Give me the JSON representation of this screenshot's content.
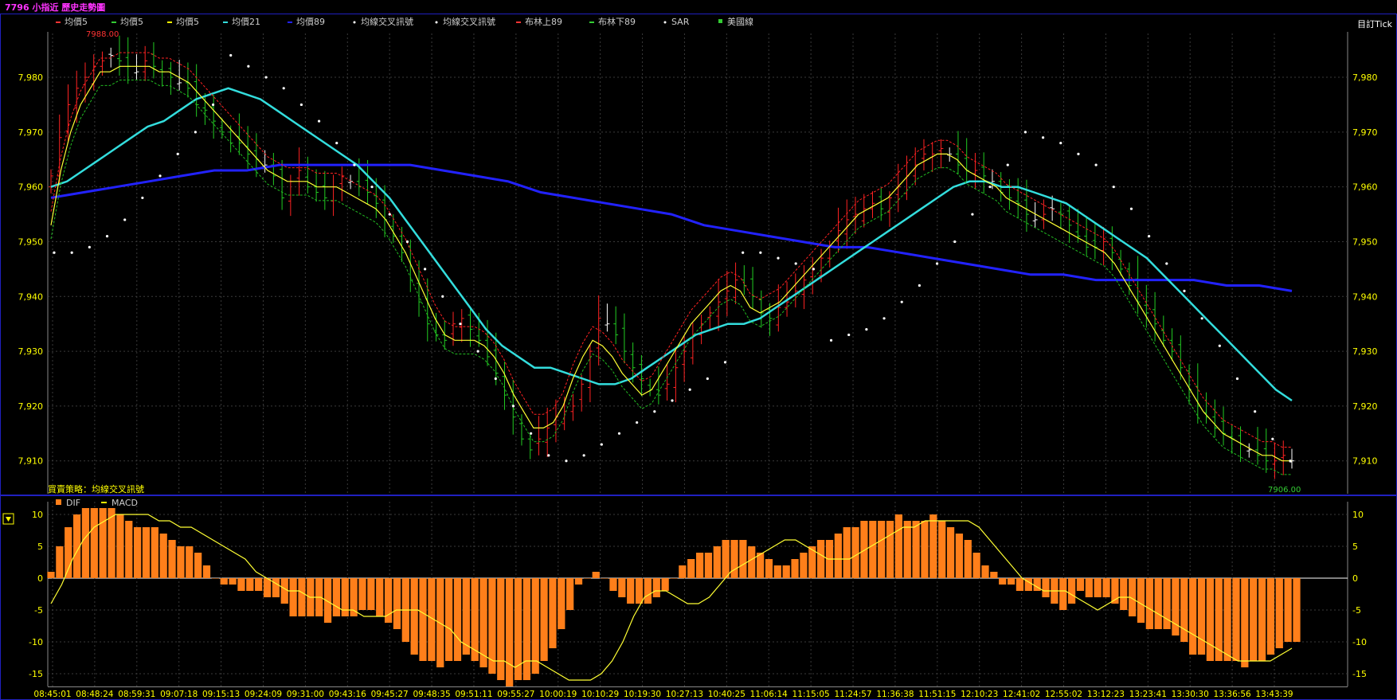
{
  "window": {
    "title": "7796 小指近  歷史走勢圖",
    "tick_label": "目訂Tick",
    "strategy_label": "買賣策略：均線交叉訊號"
  },
  "legend_main": [
    {
      "label": "均價5",
      "color": "#ff3333",
      "marker": "dash"
    },
    {
      "label": "均價5",
      "color": "#33cc33",
      "marker": "dash"
    },
    {
      "label": "均價5",
      "color": "#ffff00",
      "marker": "dash"
    },
    {
      "label": "均價21",
      "color": "#33dddd",
      "marker": "dash"
    },
    {
      "label": "均價89",
      "color": "#2222ff",
      "marker": "dash"
    },
    {
      "label": "均線交叉訊號",
      "color": "#ffffff",
      "marker": "dot"
    },
    {
      "label": "均線交叉訊號",
      "color": "#ffffff",
      "marker": "dot"
    },
    {
      "label": "布林上89",
      "color": "#ff3333",
      "marker": "dash"
    },
    {
      "label": "布林下89",
      "color": "#33cc33",
      "marker": "dash"
    },
    {
      "label": "SAR",
      "color": "#ffffff",
      "marker": "dot"
    },
    {
      "label": "美國線",
      "color": "#33cc33",
      "marker": "square"
    }
  ],
  "legend_macd": [
    {
      "label": "DIF",
      "color": "#ff7f1a",
      "marker": "square"
    },
    {
      "label": "MACD",
      "color": "#ffff00",
      "marker": "dash"
    }
  ],
  "colors": {
    "up": "#ff2222",
    "down": "#22cc22",
    "neutral": "#ffffff",
    "ma_yellow": "#ffff33",
    "ma21": "#33dddd",
    "ma89": "#2222ff",
    "boll": "#ff2222",
    "boll_low": "#22bb22",
    "sar": "#ffffff",
    "dif": "#ff7f1a",
    "macd": "#ffff33",
    "axis_text": "#ffff00",
    "grid": "#3a3a3a",
    "frame": "#2020c0"
  },
  "chart_data": [
    {
      "type": "candlestick",
      "title": "7796 小指近  歷史走勢圖",
      "ylim": [
        7904,
        7988
      ],
      "yticks": [
        7910,
        7920,
        7930,
        7940,
        7950,
        7960,
        7970,
        7980
      ],
      "ytick_labels": [
        "7,910",
        "7,920",
        "7,930",
        "7,940",
        "7,950",
        "7,960",
        "7,970",
        "7,980"
      ],
      "max_marker": "7988.00",
      "min_marker": "7906.00",
      "close": [
        7962,
        7969,
        7975,
        7978,
        7980,
        7982,
        7983,
        7984,
        7983,
        7982,
        7981,
        7983,
        7982,
        7981,
        7980,
        7979,
        7978,
        7975,
        7974,
        7972,
        7970,
        7968,
        7968,
        7966,
        7965,
        7964,
        7962,
        7958,
        7961,
        7963,
        7960,
        7959,
        7958,
        7960,
        7962,
        7961,
        7960,
        7959,
        7957,
        7954,
        7951,
        7948,
        7943,
        7939,
        7935,
        7933,
        7932,
        7935,
        7936,
        7934,
        7932,
        7929,
        7926,
        7922,
        7918,
        7914,
        7912,
        7914,
        7916,
        7918,
        7919,
        7920,
        7924,
        7930,
        7936,
        7935,
        7933,
        7930,
        7927,
        7925,
        7923,
        7922,
        7924,
        7927,
        7930,
        7933,
        7935,
        7937,
        7939,
        7941,
        7943,
        7942,
        7940,
        7937,
        7936,
        7938,
        7939,
        7941,
        7943,
        7945,
        7947,
        7949,
        7952,
        7954,
        7955,
        7956,
        7957,
        7956,
        7958,
        7960,
        7962,
        7964,
        7966,
        7966,
        7967,
        7966,
        7964,
        7963,
        7963,
        7962,
        7961,
        7959,
        7958,
        7957,
        7955,
        7954,
        7955,
        7956,
        7955,
        7953,
        7951,
        7949,
        7949,
        7950,
        7948,
        7945,
        7942,
        7939,
        7937,
        7935,
        7932,
        7930,
        7927,
        7923,
        7920,
        7918,
        7916,
        7915,
        7914,
        7913,
        7912,
        7911,
        7910,
        7910,
        7911,
        7910
      ],
      "ma5_yellow": [
        7953,
        7963,
        7970,
        7975,
        7978,
        7981,
        7981,
        7982,
        7982,
        7982,
        7982,
        7981,
        7981,
        7980,
        7979,
        7977,
        7975,
        7973,
        7971,
        7969,
        7967,
        7965,
        7963,
        7962,
        7961,
        7961,
        7961,
        7960,
        7960,
        7960,
        7959,
        7958,
        7957,
        7956,
        7954,
        7951,
        7948,
        7944,
        7940,
        7936,
        7933,
        7932,
        7932,
        7932,
        7931,
        7929,
        7926,
        7922,
        7919,
        7916,
        7916,
        7917,
        7920,
        7925,
        7929,
        7932,
        7931,
        7929,
        7926,
        7924,
        7922,
        7923,
        7926,
        7929,
        7932,
        7935,
        7937,
        7939,
        7941,
        7942,
        7941,
        7938,
        7937,
        7938,
        7939,
        7941,
        7943,
        7945,
        7947,
        7949,
        7951,
        7953,
        7955,
        7956,
        7957,
        7958,
        7960,
        7962,
        7964,
        7965,
        7966,
        7966,
        7965,
        7963,
        7962,
        7961,
        7960,
        7958,
        7957,
        7956,
        7955,
        7954,
        7953,
        7952,
        7951,
        7950,
        7949,
        7948,
        7946,
        7943,
        7940,
        7937,
        7934,
        7931,
        7928,
        7925,
        7922,
        7919,
        7917,
        7915,
        7914,
        7913,
        7912,
        7911,
        7911,
        7910,
        7910
      ],
      "ma21": [
        7960,
        7961,
        7963,
        7965,
        7967,
        7969,
        7971,
        7972,
        7974,
        7976,
        7977,
        7978,
        7977,
        7976,
        7974,
        7972,
        7970,
        7968,
        7966,
        7964,
        7961,
        7958,
        7954,
        7950,
        7946,
        7942,
        7938,
        7934,
        7931,
        7929,
        7927,
        7927,
        7926,
        7925,
        7924,
        7924,
        7925,
        7927,
        7929,
        7931,
        7933,
        7934,
        7935,
        7935,
        7936,
        7938,
        7940,
        7942,
        7944,
        7946,
        7948,
        7950,
        7952,
        7954,
        7956,
        7958,
        7960,
        7961,
        7961,
        7960,
        7960,
        7959,
        7958,
        7957,
        7955,
        7953,
        7951,
        7949,
        7947,
        7944,
        7941,
        7938,
        7935,
        7932,
        7929,
        7926,
        7923,
        7921
      ],
      "ma89": [
        7958,
        7959,
        7960,
        7961,
        7962,
        7963,
        7963,
        7964,
        7964,
        7964,
        7964,
        7964,
        7963,
        7962,
        7961,
        7959,
        7958,
        7957,
        7956,
        7955,
        7953,
        7952,
        7951,
        7950,
        7949,
        7949,
        7948,
        7947,
        7946,
        7945,
        7944,
        7944,
        7943,
        7943,
        7943,
        7943,
        7942,
        7942,
        7941
      ],
      "sar": [
        7948,
        7948,
        7949,
        7951,
        7954,
        7958,
        7962,
        7966,
        7970,
        7975,
        7984,
        7982,
        7980,
        7978,
        7975,
        7972,
        7968,
        7964,
        7960,
        7955,
        7950,
        7945,
        7940,
        7935,
        7930,
        7925,
        7920,
        7915,
        7911,
        7910,
        7911,
        7913,
        7915,
        7917,
        7919,
        7921,
        7923,
        7925,
        7928,
        7948,
        7948,
        7947,
        7946,
        7945,
        7932,
        7933,
        7934,
        7936,
        7939,
        7942,
        7946,
        7950,
        7955,
        7960,
        7964,
        7970,
        7969,
        7968,
        7966,
        7964,
        7960,
        7956,
        7951,
        7946,
        7941,
        7936,
        7931,
        7925,
        7919,
        7914,
        7910
      ]
    },
    {
      "type": "bar",
      "title": "MACD",
      "series": [
        {
          "name": "DIF",
          "values": [
            1,
            5,
            8,
            10,
            11,
            11,
            11,
            11,
            10,
            9,
            8,
            8,
            8,
            7,
            6,
            5,
            5,
            4,
            2,
            0,
            -1,
            -1,
            -2,
            -2,
            -2,
            -3,
            -3,
            -4,
            -6,
            -6,
            -6,
            -6,
            -7,
            -6,
            -6,
            -6,
            -5,
            -5,
            -6,
            -7,
            -8,
            -10,
            -12,
            -13,
            -13,
            -14,
            -13,
            -13,
            -12,
            -13,
            -14,
            -15,
            -16,
            -17,
            -16,
            -16,
            -15,
            -13,
            -11,
            -8,
            -5,
            -1,
            0,
            1,
            0,
            -2,
            -3,
            -4,
            -4,
            -4,
            -3,
            -2,
            0,
            2,
            3,
            4,
            4,
            5,
            6,
            6,
            6,
            5,
            4,
            3,
            2,
            2,
            3,
            4,
            5,
            6,
            6,
            7,
            8,
            8,
            9,
            9,
            9,
            9,
            10,
            9,
            9,
            9,
            10,
            9,
            8,
            7,
            6,
            4,
            2,
            1,
            -1,
            -1,
            -2,
            -2,
            -2,
            -3,
            -4,
            -5,
            -4,
            -2,
            -3,
            -3,
            -3,
            -4,
            -5,
            -6,
            -7,
            -8,
            -8,
            -8,
            -9,
            -10,
            -12,
            -12,
            -13,
            -13,
            -13,
            -13,
            -14,
            -13,
            -13,
            -12,
            -11,
            -10,
            -10
          ]
        },
        {
          "name": "MACD",
          "values": [
            -4,
            -1,
            3,
            6,
            8,
            9,
            10,
            10,
            10,
            10,
            9,
            9,
            8,
            8,
            7,
            6,
            5,
            4,
            3,
            1,
            0,
            -1,
            -2,
            -2,
            -3,
            -3,
            -4,
            -5,
            -5,
            -6,
            -6,
            -6,
            -5,
            -5,
            -5,
            -6,
            -7,
            -8,
            -10,
            -11,
            -12,
            -13,
            -13,
            -14,
            -13,
            -13,
            -14,
            -15,
            -16,
            -16,
            -16,
            -15,
            -13,
            -10,
            -6,
            -3,
            -2,
            -2,
            -3,
            -4,
            -4,
            -3,
            -1,
            1,
            2,
            3,
            4,
            5,
            6,
            6,
            5,
            4,
            3,
            3,
            3,
            4,
            5,
            6,
            7,
            8,
            8,
            9,
            9,
            9,
            9,
            9,
            8,
            6,
            4,
            2,
            0,
            -1,
            -2,
            -2,
            -2,
            -3,
            -4,
            -5,
            -4,
            -3,
            -3,
            -4,
            -5,
            -6,
            -7,
            -8,
            -9,
            -10,
            -11,
            -12,
            -13,
            -13,
            -13,
            -13,
            -12,
            -11
          ]
        }
      ],
      "ylim": [
        -17,
        12
      ],
      "yticks": [
        10,
        5,
        0,
        -5,
        -10,
        -15
      ],
      "ytick_labels": [
        "10",
        "5",
        "0",
        "-5",
        "-10",
        "-15"
      ],
      "x_labels": [
        "08:45:01",
        "08:48:24",
        "08:59:31",
        "09:07:18",
        "09:15:13",
        "09:24:09",
        "09:31:00",
        "09:43:16",
        "09:45:27",
        "09:48:35",
        "09:51:11",
        "09:55:27",
        "10:00:19",
        "10:10:29",
        "10:19:30",
        "10:27:13",
        "10:40:25",
        "11:06:14",
        "11:15:05",
        "11:24:57",
        "11:36:38",
        "11:51:15",
        "12:10:23",
        "12:41:02",
        "12:55:02",
        "13:12:23",
        "13:23:41",
        "13:30:30",
        "13:36:56",
        "13:43:39"
      ]
    }
  ]
}
